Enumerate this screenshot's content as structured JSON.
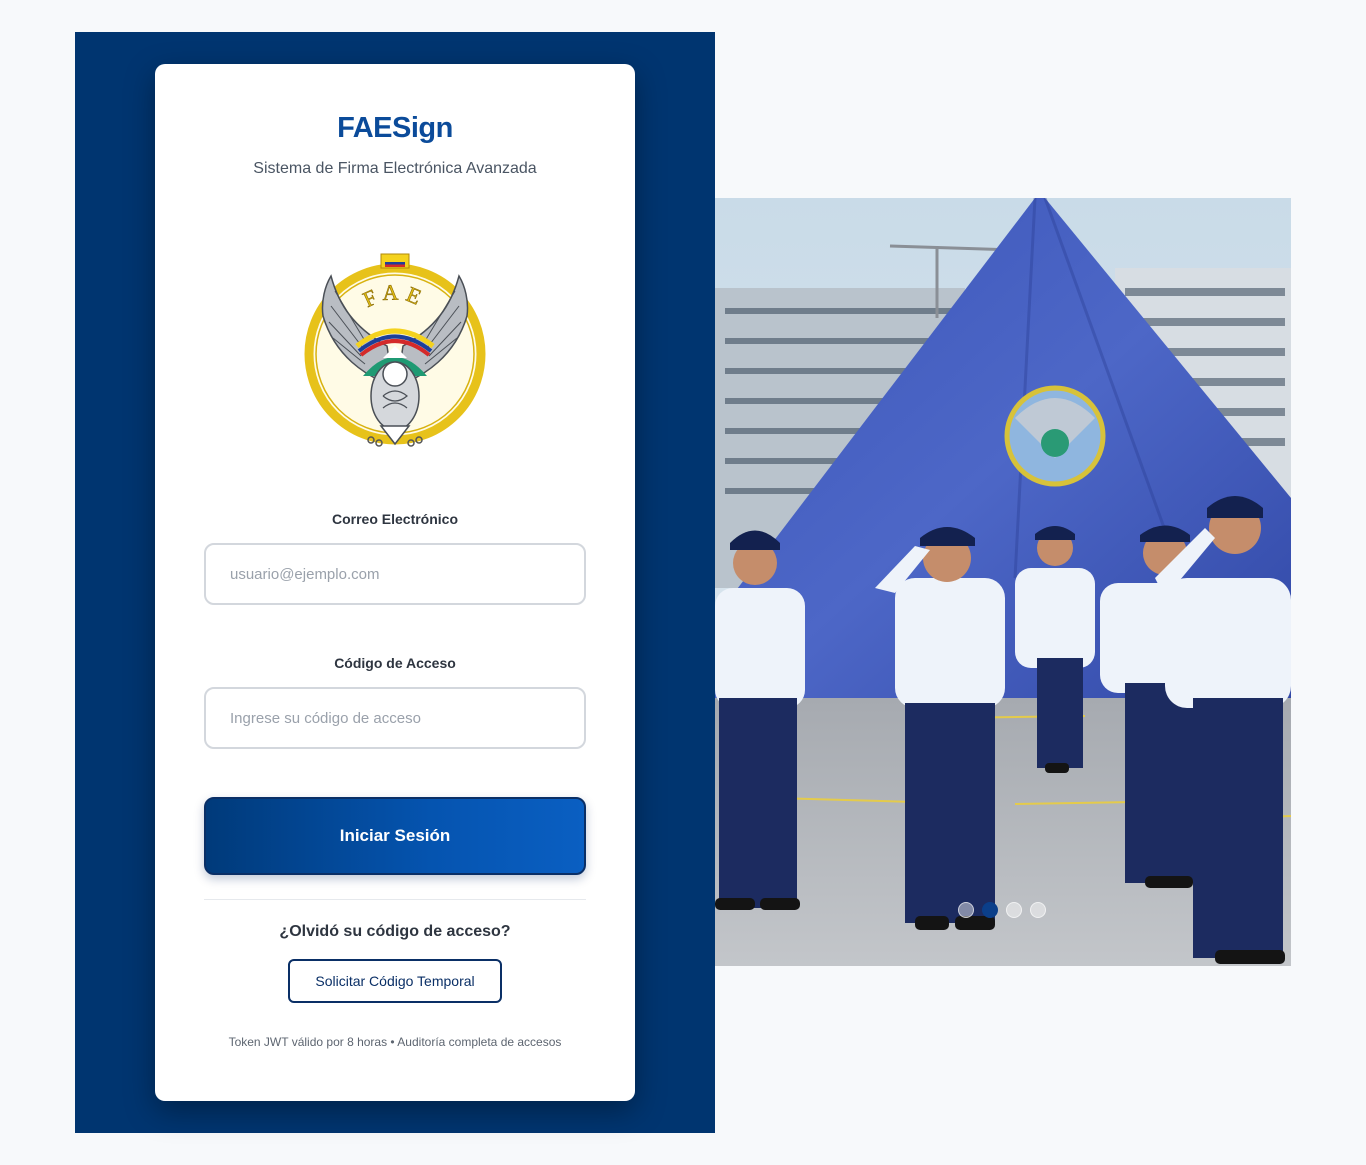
{
  "app": {
    "title": "FAESign",
    "subtitle": "Sistema de Firma Electrónica Avanzada",
    "emblem_text": "FAE"
  },
  "form": {
    "email_label": "Correo Electrónico",
    "email_placeholder": "usuario@ejemplo.com",
    "email_value": "",
    "code_label": "Código de Acceso",
    "code_placeholder": "Ingrese su código de acceso",
    "code_value": "",
    "submit_label": "Iniciar Sesión"
  },
  "recovery": {
    "question": "¿Olvidó su código de acceso?",
    "button_label": "Solicitar Código Temporal"
  },
  "footer": {
    "note": "Token JWT válido por 8 horas • Auditoría completa de accesos"
  },
  "carousel": {
    "slide_count": 4,
    "active_index": 1
  },
  "colors": {
    "panel": "#003570",
    "brand_title": "#0b4b9a",
    "button_dark": "#003a7a",
    "button_light": "#0a5fc2",
    "active_dot": "#0b3f8a"
  }
}
